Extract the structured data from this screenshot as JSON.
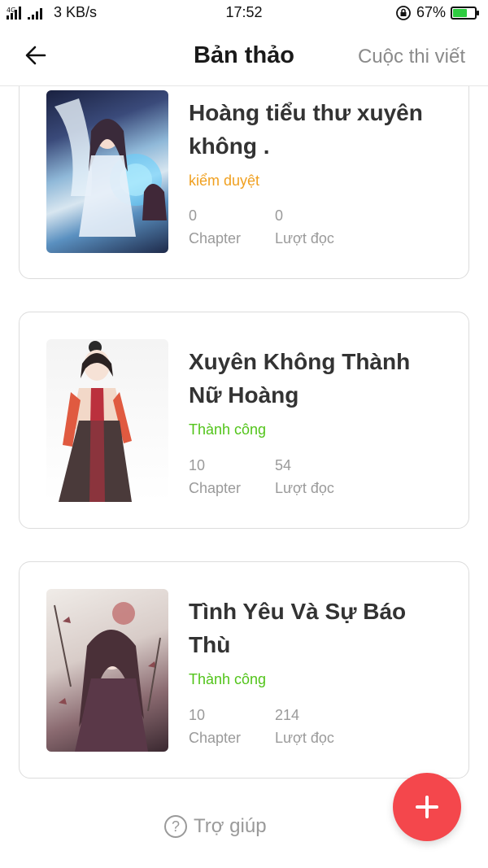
{
  "status_bar": {
    "network": "4G",
    "speed": "3 KB/s",
    "time": "17:52",
    "battery_percent": "67%",
    "battery_level": 0.67
  },
  "header": {
    "title": "Bản thảo",
    "contest_link": "Cuộc thi viết"
  },
  "books": [
    {
      "title": "Hoàng tiểu thư xuyên không .",
      "status": "kiểm duyệt",
      "status_color": "#f0a020",
      "chapters": "0",
      "chapters_label": "Chapter",
      "reads": "0",
      "reads_label": "Lượt đọc"
    },
    {
      "title": "Xuyên Không Thành Nữ Hoàng",
      "status": "Thành công",
      "status_color": "#52c41a",
      "chapters": "10",
      "chapters_label": "Chapter",
      "reads": "54",
      "reads_label": "Lượt đọc"
    },
    {
      "title": "Tình Yêu Và Sự Báo Thù",
      "status": "Thành công",
      "status_color": "#52c41a",
      "chapters": "10",
      "chapters_label": "Chapter",
      "reads": "214",
      "reads_label": "Lượt đọc"
    }
  ],
  "help": {
    "label": "Trợ giúp",
    "icon": "?"
  },
  "fab": {
    "icon": "plus-icon",
    "color": "#f4474c"
  }
}
